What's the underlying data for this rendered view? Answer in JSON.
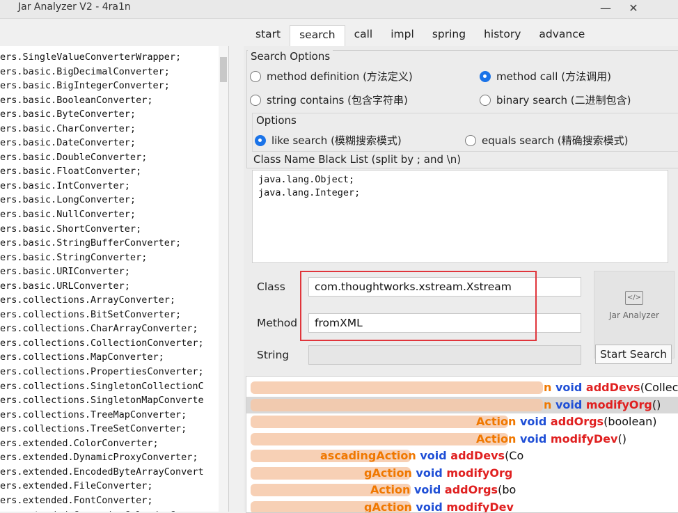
{
  "window": {
    "title": "Jar Analyzer V2 - 4ra1n",
    "min_symbol": "—",
    "close_symbol": "✕"
  },
  "class_list": [
    "ers.SingleValueConverterWrapper;",
    "ers.basic.BigDecimalConverter;",
    "ers.basic.BigIntegerConverter;",
    "ers.basic.BooleanConverter;",
    "ers.basic.ByteConverter;",
    "ers.basic.CharConverter;",
    "ers.basic.DateConverter;",
    "ers.basic.DoubleConverter;",
    "ers.basic.FloatConverter;",
    "ers.basic.IntConverter;",
    "ers.basic.LongConverter;",
    "ers.basic.NullConverter;",
    "ers.basic.ShortConverter;",
    "ers.basic.StringBufferConverter;",
    "ers.basic.StringConverter;",
    "ers.basic.URIConverter;",
    "ers.basic.URLConverter;",
    "ers.collections.ArrayConverter;",
    "ers.collections.BitSetConverter;",
    "ers.collections.CharArrayConverter;",
    "ers.collections.CollectionConverter;",
    "ers.collections.MapConverter;",
    "ers.collections.PropertiesConverter;",
    "ers.collections.SingletonCollectionC",
    "ers.collections.SingletonMapConverte",
    "ers.collections.TreeMapConverter;",
    "ers.collections.TreeSetConverter;",
    "ers.extended.ColorConverter;",
    "ers.extended.DynamicProxyConverter;",
    "ers.extended.EncodedByteArrayConvert",
    "ers.extended.FileConverter;",
    "ers.extended.FontConverter;",
    "ers.extended.GregorianCalendarConv"
  ],
  "tabs": [
    "start",
    "search",
    "call",
    "impl",
    "spring",
    "history",
    "advance"
  ],
  "search_options": {
    "title": "Search Options",
    "method_definition": "method definition (方法定义)",
    "method_call": "method call (方法调用)",
    "string_contains": "string contains (包含字符串)",
    "binary_search": "binary search (二进制包含)",
    "selected": "method call (方法调用)"
  },
  "options": {
    "title": "Options",
    "like_search": "like search (模糊搜索模式)",
    "equals_search": "equals search (精确搜索模式)",
    "selected": "like search (模糊搜索模式)"
  },
  "blacklist": {
    "label": "Class Name Black List (split by ; and \\n)",
    "value": "java.lang.Object;\njava.lang.Integer;"
  },
  "fields": {
    "class_label": "Class",
    "class_value": "com.thoughtworks.xstream.Xstream",
    "method_label": "Method",
    "method_value": "fromXML",
    "string_label": "String",
    "string_value": ""
  },
  "logo": {
    "glyph": "</>",
    "text": "Jar Analyzer"
  },
  "start_search": "Start Search",
  "results": [
    {
      "prefix": "n",
      "ret": "void",
      "name": "addDevs",
      "args": "(Collection"
    },
    {
      "prefix": "n",
      "ret": "void",
      "name": "modifyOrg",
      "args": "()"
    },
    {
      "prefix": "Action",
      "ret": "void",
      "name": "addOrgs",
      "args": "(boolean)"
    },
    {
      "prefix": "Action",
      "ret": "void",
      "name": "modifyDev",
      "args": "()"
    },
    {
      "prefix": "ascadingAction",
      "ret": "void",
      "name": "addDevs",
      "args": "(Co"
    },
    {
      "prefix": "gAction",
      "ret": "void",
      "name": "modifyOrg",
      "args": ""
    },
    {
      "prefix": "Action",
      "ret": "void",
      "name": "addOrgs",
      "args": "(bo"
    },
    {
      "prefix": "gAction",
      "ret": "void",
      "name": "modifyDev",
      "args": ""
    }
  ],
  "colors": {
    "accent": "#1a73e8",
    "highlight_box": "#e0353b",
    "result_prefix": "#f07800",
    "result_keyword": "#1f4fd6",
    "result_method": "#e02020"
  }
}
